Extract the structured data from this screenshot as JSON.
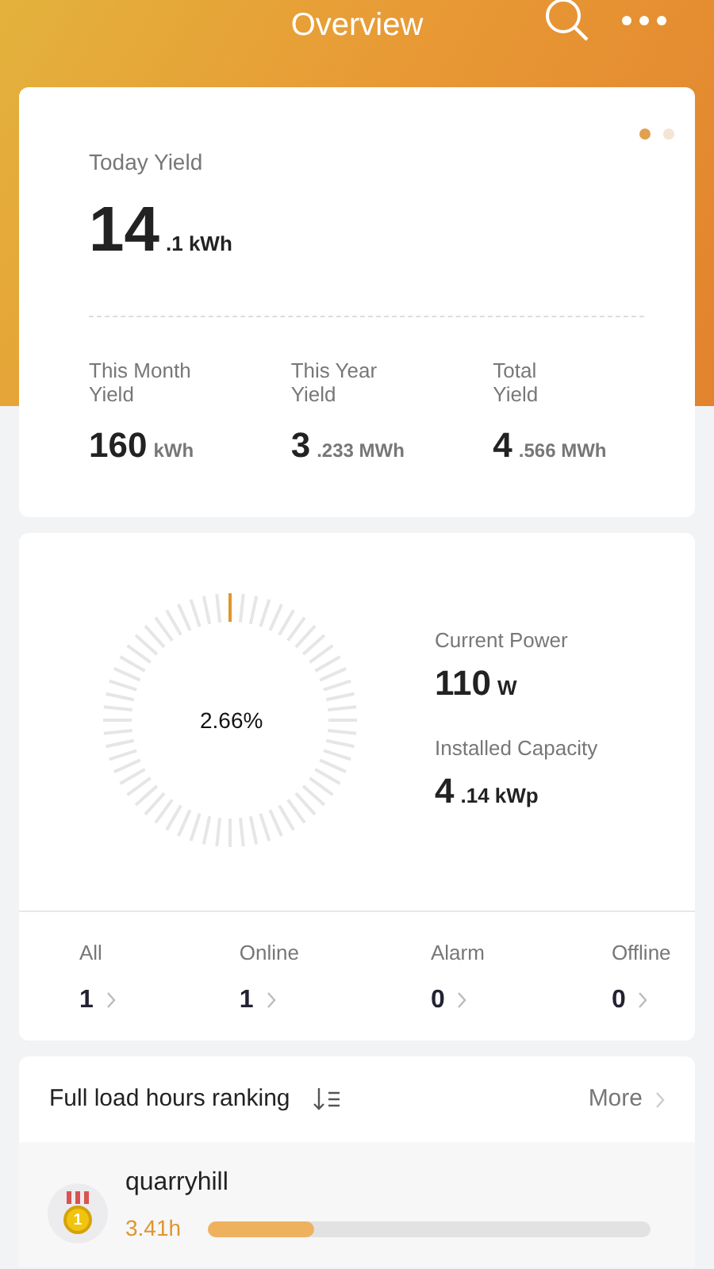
{
  "header": {
    "title": "Overview"
  },
  "pager": [
    {
      "selected": true
    },
    {
      "selected": false
    }
  ],
  "today": {
    "label": "Today Yield",
    "main": "14",
    "unit": ".1 kWh"
  },
  "yields": [
    {
      "label": "This Month Yield",
      "main": "160",
      "unit": "kWh"
    },
    {
      "label": "This Year Yield",
      "main": "3",
      "unit": ".233 MWh"
    },
    {
      "label": "Total Yield",
      "main": "4",
      "unit": ".566 MWh"
    }
  ],
  "gauge": {
    "reading": "2.66%"
  },
  "power": [
    {
      "label": "Current Power",
      "main": "110",
      "unit": "W"
    },
    {
      "label": "Installed Capacity",
      "main": "4",
      "unit": ".14 kWp"
    }
  ],
  "devices": [
    {
      "label": "All",
      "count": "1"
    },
    {
      "label": "Online",
      "count": "1"
    },
    {
      "label": "Alarm",
      "count": "0"
    },
    {
      "label": "Offline",
      "count": "0"
    }
  ],
  "ranking": {
    "title": "Full load hours ranking",
    "more": "More",
    "items": [
      {
        "rank": "1",
        "name": "quarryhill",
        "hours": "3.41h",
        "level": 0.24
      }
    ]
  }
}
